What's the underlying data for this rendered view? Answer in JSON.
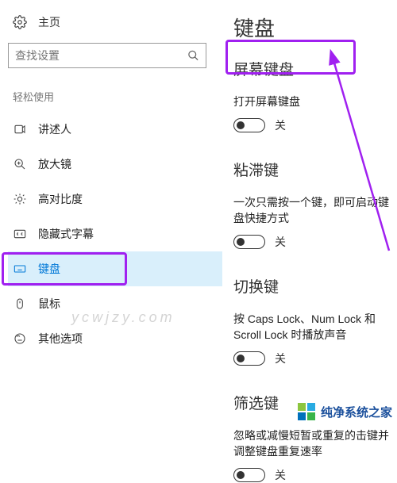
{
  "sidebar": {
    "home": "主页",
    "search_placeholder": "查找设置",
    "category": "轻松使用",
    "items": [
      {
        "label": "讲述人"
      },
      {
        "label": "放大镜"
      },
      {
        "label": "高对比度"
      },
      {
        "label": "隐藏式字幕"
      },
      {
        "label": "键盘"
      },
      {
        "label": "鼠标"
      },
      {
        "label": "其他选项"
      }
    ]
  },
  "content": {
    "title": "键盘",
    "sections": [
      {
        "heading": "屏幕键盘",
        "desc": "打开屏幕键盘",
        "toggle_state": "关"
      },
      {
        "heading": "粘滞键",
        "desc": "一次只需按一个键，即可启动键盘快捷方式",
        "toggle_state": "关"
      },
      {
        "heading": "切换键",
        "desc": "按 Caps Lock、Num Lock 和 Scroll Lock 时播放声音",
        "toggle_state": "关"
      },
      {
        "heading": "筛选键",
        "desc": "忽略或减慢短暂或重复的击键并调整键盘重复速率",
        "toggle_state": "关"
      }
    ]
  },
  "watermark": "ycwjzy.com",
  "footer": "纯净系统之家"
}
